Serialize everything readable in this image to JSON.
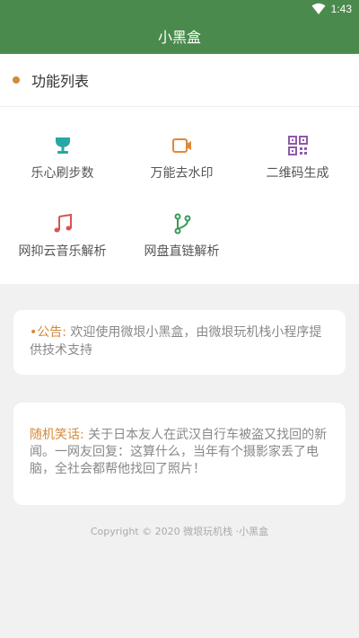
{
  "status_bar": {
    "time": "1:43"
  },
  "header": {
    "title": "小黑盒"
  },
  "section": {
    "title": "功能列表"
  },
  "functions": [
    {
      "label": "乐心刷步数",
      "icon": "trophy-icon",
      "color": "#2aa6a3"
    },
    {
      "label": "万能去水印",
      "icon": "video-camera-icon",
      "color": "#e0893a"
    },
    {
      "label": "二维码生成",
      "icon": "qr-code-icon",
      "color": "#8e5aa8"
    },
    {
      "label": "网抑云音乐解析",
      "icon": "music-note-icon",
      "color": "#d9534f"
    },
    {
      "label": "网盘直链解析",
      "icon": "branch-icon",
      "color": "#3a9a57"
    }
  ],
  "notice": {
    "prefix": "•公告:",
    "text": " 欢迎使用微垠小黑盒，由微垠玩机栈小程序提供技术支持"
  },
  "joke": {
    "prefix": "随机笑话:",
    "text": " 关于日本友人在武汉自行车被盗又找回的新闻。一网友回复：这算什么，当年有个摄影家丢了电脑，全社会都帮他找回了照片！"
  },
  "footer": {
    "text": "Copyright © 2020 微垠玩机栈 ·小黑盒"
  },
  "colors": {
    "header_bg": "#4a8b4d",
    "accent": "#d4893a",
    "page_bg": "#f1f1f1"
  }
}
